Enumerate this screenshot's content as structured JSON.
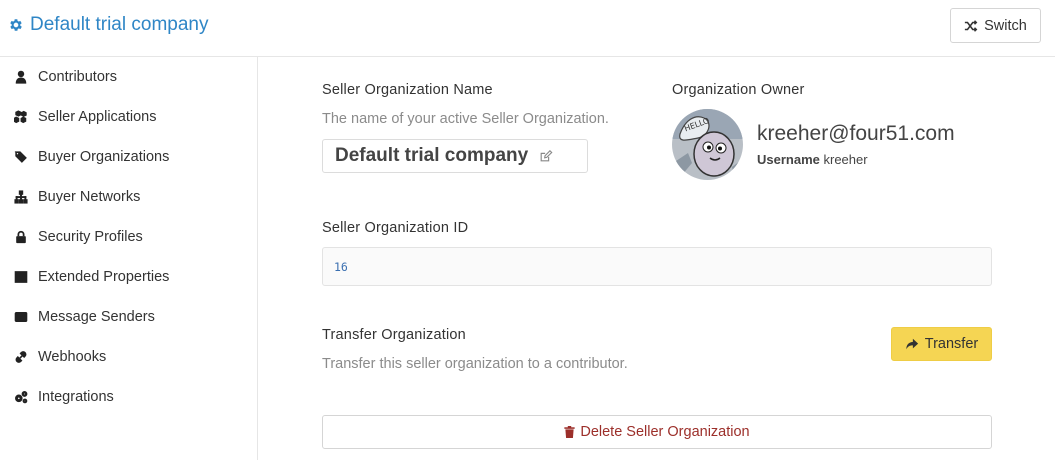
{
  "header": {
    "title": "Default trial company",
    "title_icon": "gear-icon",
    "switch_label": "Switch",
    "switch_icon": "shuffle-icon"
  },
  "sidebar": {
    "items": [
      {
        "label": "Contributors",
        "icon": "user-icon"
      },
      {
        "label": "Seller Applications",
        "icon": "cubes-icon"
      },
      {
        "label": "Buyer Organizations",
        "icon": "tags-icon"
      },
      {
        "label": "Buyer Networks",
        "icon": "sitemap-icon"
      },
      {
        "label": "Security Profiles",
        "icon": "lock-icon"
      },
      {
        "label": "Extended Properties",
        "icon": "table-icon"
      },
      {
        "label": "Message Senders",
        "icon": "envelope-icon"
      },
      {
        "label": "Webhooks",
        "icon": "link-icon"
      },
      {
        "label": "Integrations",
        "icon": "cogs-icon"
      }
    ]
  },
  "main": {
    "org_name": {
      "label": "Seller Organization Name",
      "help": "The name of your active Seller Organization.",
      "value": "Default trial company"
    },
    "owner": {
      "label": "Organization Owner",
      "email": "kreeher@four51.com",
      "username_label": "Username",
      "username": "kreeher"
    },
    "org_id": {
      "label": "Seller Organization ID",
      "value": "16"
    },
    "transfer": {
      "label": "Transfer Organization",
      "help": "Transfer this seller organization to a contributor.",
      "button": "Transfer"
    },
    "delete_button": "Delete Seller Organization"
  },
  "colors": {
    "accent": "#2f86c6",
    "transfer_bg": "#f5d553",
    "danger": "#9c2f2a"
  }
}
